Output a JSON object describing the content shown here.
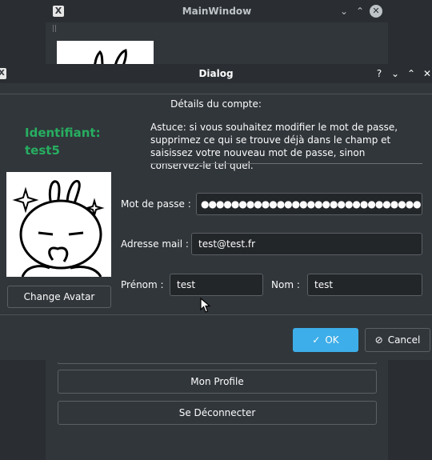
{
  "main_window": {
    "title": "MainWindow",
    "app_icon": "X",
    "buttons": {
      "mon_profile": "Mon Profile",
      "se_deconnecter": "Se Déconnecter"
    }
  },
  "dialog": {
    "title": "Dialog",
    "app_icon": "X",
    "titlebar_icons": [
      "help-icon",
      "minimize-icon",
      "maximize-icon",
      "close-icon"
    ],
    "group_title": "Détails du compte:",
    "identifiant": "Identifiant: test5",
    "hint": "Astuce: si vous souhaitez modifier le mot de passe, supprimez ce qui se trouve déjà dans le champ et saisissez votre nouveau mot de passe, sinon conservez-le tel quel.",
    "change_avatar_label": "Change Avatar",
    "fields": {
      "password_label": "Mot de passe  :",
      "password_value": "●●●●●●●●●●●●●●●●●●●●●●●●●●●●●",
      "email_label": "Adresse mail :",
      "email_value": "test@test.fr",
      "prenom_label": "Prénom :",
      "prenom_value": "test",
      "nom_label": "Nom :",
      "nom_value": "test"
    },
    "ok_label": "OK",
    "cancel_label": "Cancel"
  },
  "colors": {
    "accent": "#3daee9",
    "identifiant": "#27ae60",
    "background": "#31363b"
  }
}
